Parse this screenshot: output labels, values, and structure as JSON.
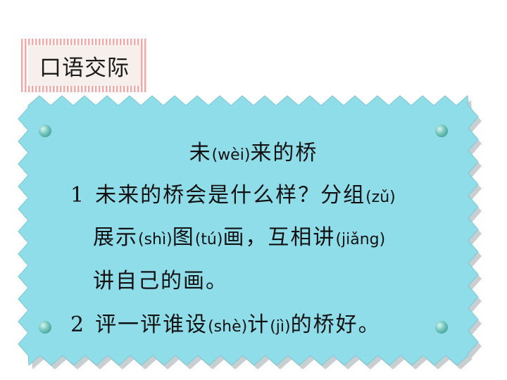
{
  "badge": {
    "label": "口语交际"
  },
  "card": {
    "title": {
      "a": "未",
      "p1": "(wèi)",
      "b": "来的桥"
    },
    "item1": {
      "number": "1",
      "line1": {
        "a": "未来的桥会是什么样？分组",
        "p1": "(zǔ)"
      },
      "line2": {
        "a": "展示",
        "p1": "(shì)",
        "b": "图",
        "p2": "(tú)",
        "c": "画，互相讲",
        "p3": "(jiǎng)"
      },
      "line3": {
        "a": "讲自己的画。"
      }
    },
    "item2": {
      "number": "2",
      "line1": {
        "a": "评一评谁设",
        "p1": "(shè)",
        "b": "计",
        "p2": "(jì)",
        "c": "的桥好。"
      }
    }
  },
  "colors": {
    "card_fill": "#8fdde9",
    "card_shadow": "#c9cfd0",
    "badge_border": "#f0a7a6",
    "badge_fill": "#f7eeea",
    "dot": "#3a9a92"
  }
}
